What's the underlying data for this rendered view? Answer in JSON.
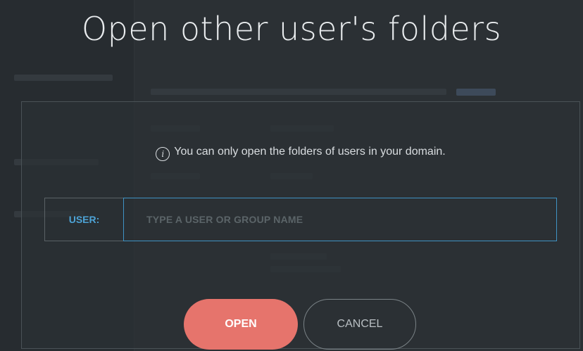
{
  "dialog": {
    "title": "Open other user's folders",
    "notice": "You can only open the folders of users in your domain.",
    "info_icon": "info-icon",
    "user_label": "USER:",
    "user_input": {
      "value": "",
      "placeholder": "TYPE A USER OR GROUP NAME"
    },
    "open_label": "OPEN",
    "cancel_label": "CANCEL"
  },
  "colors": {
    "background": "#2b3034",
    "accent_blue": "#3f93c4",
    "label_blue": "#4da3d6",
    "open_button": "#e6746c"
  }
}
